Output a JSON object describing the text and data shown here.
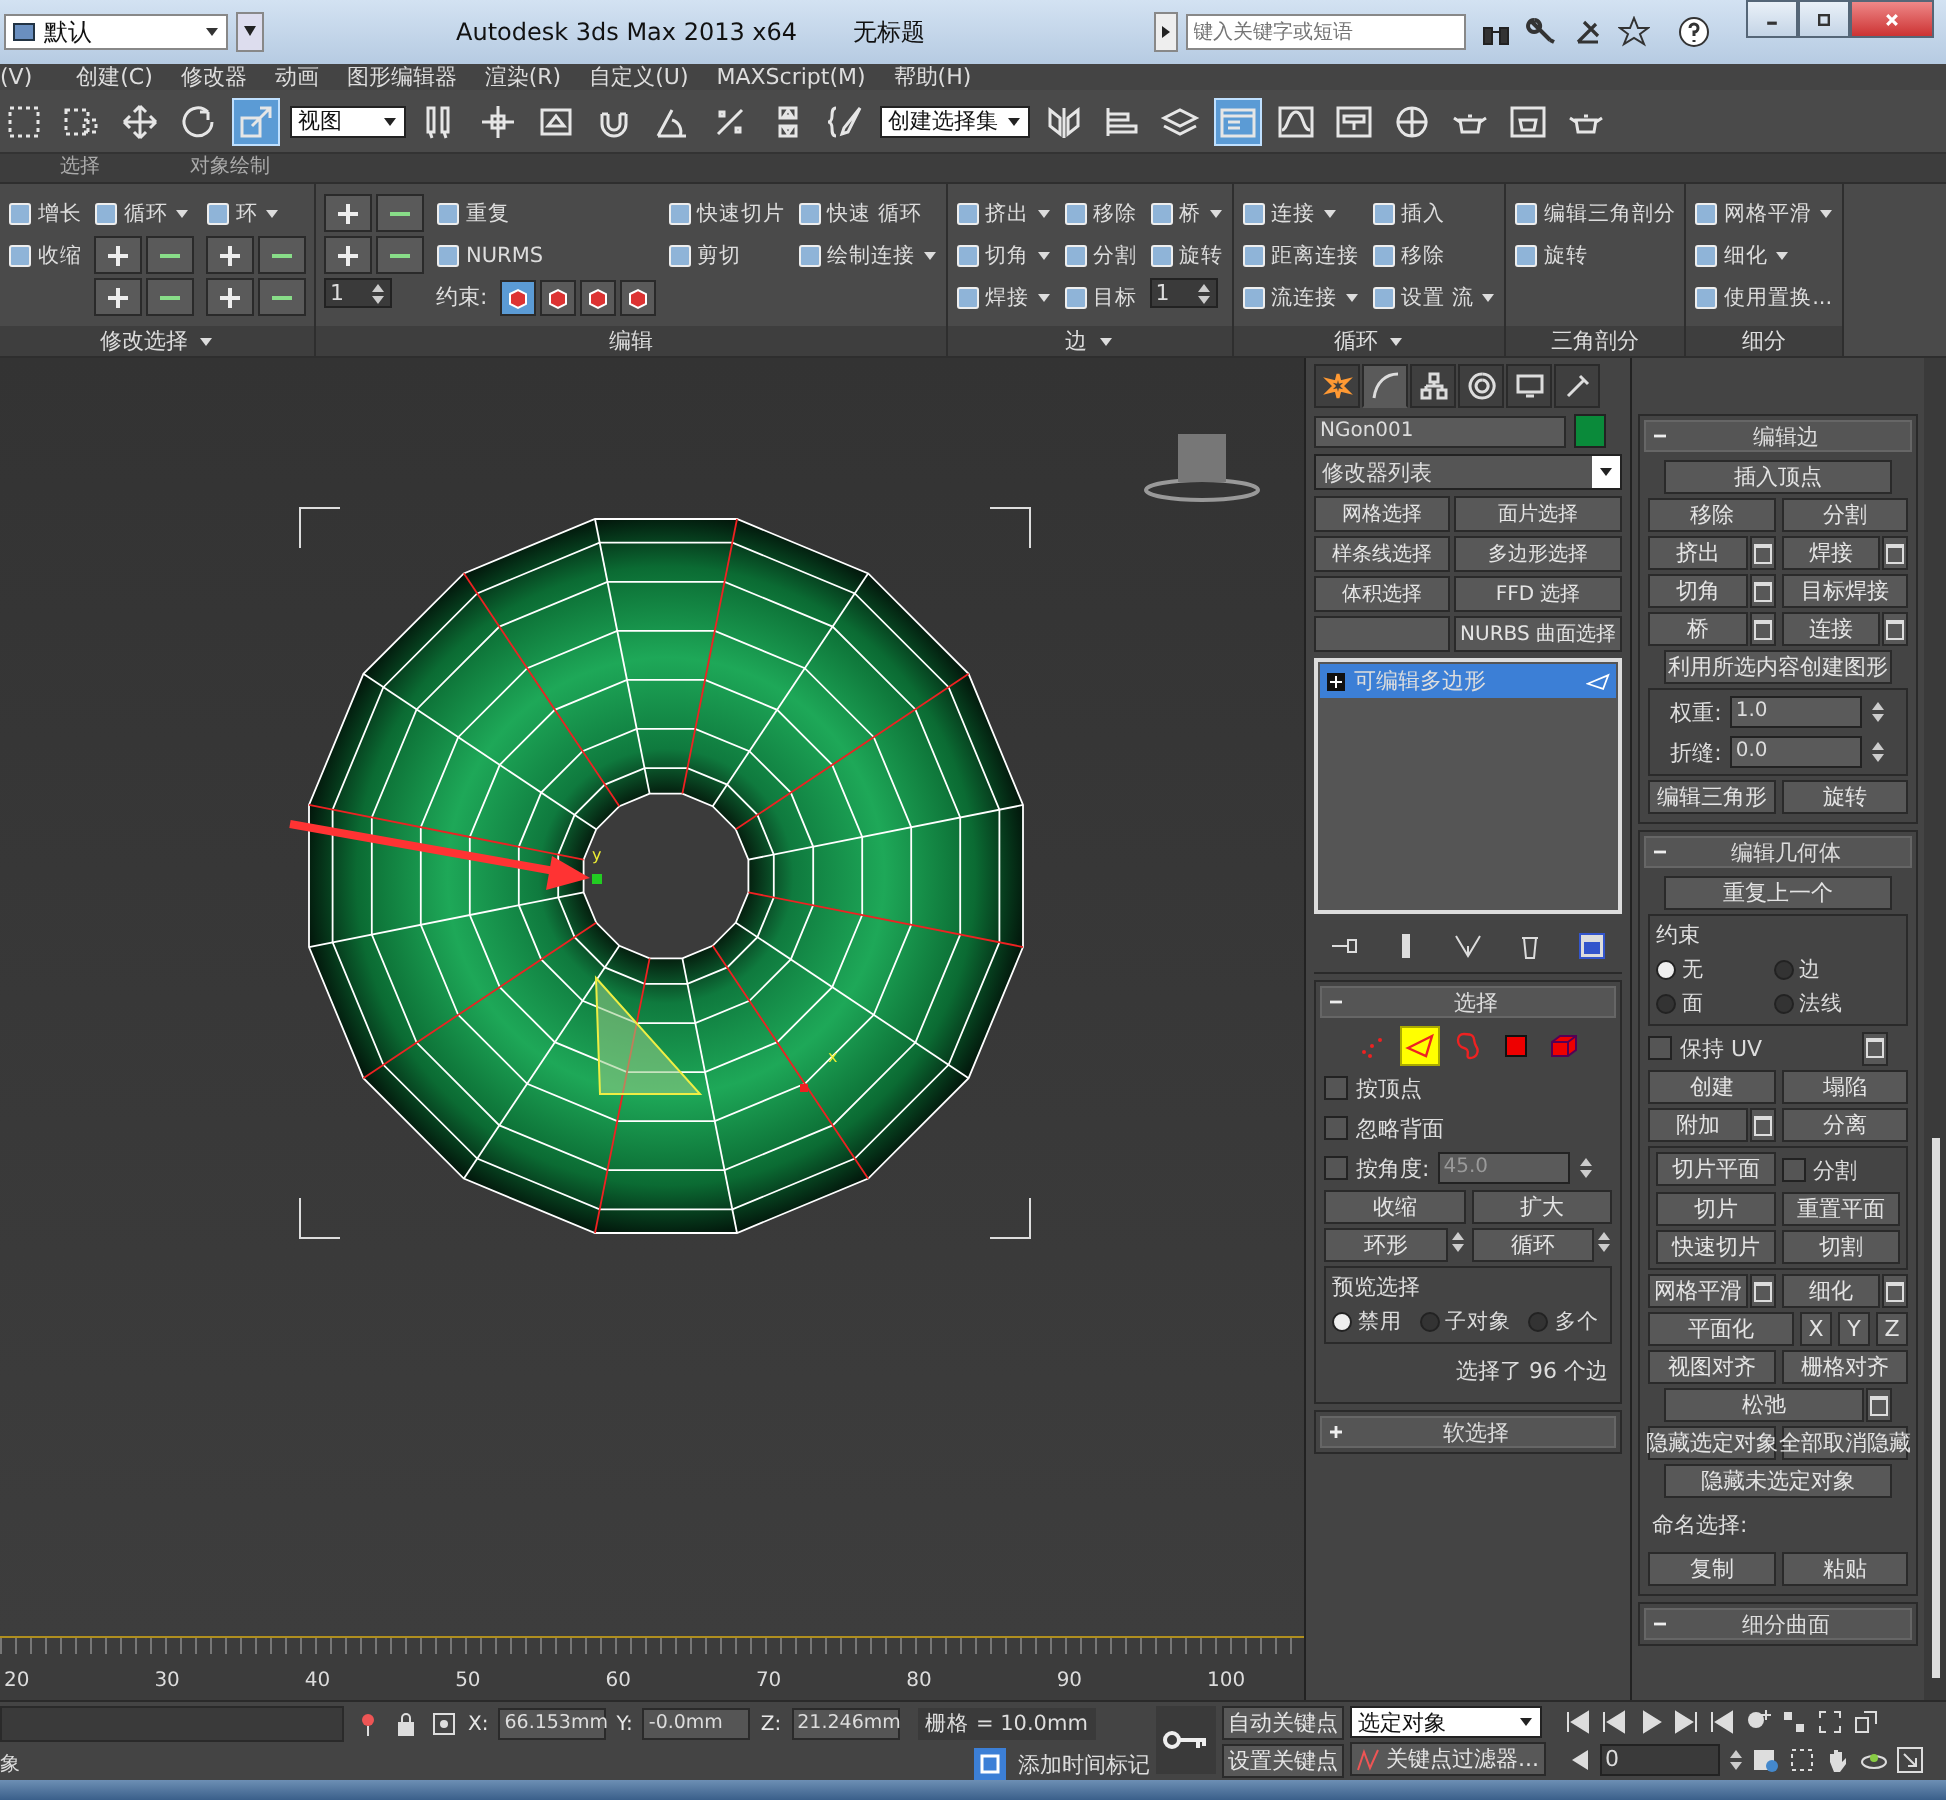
{
  "title_bar": {
    "workspace": "默认",
    "app_title": "Autodesk 3ds Max 2013 x64",
    "document_title": "无标题",
    "search": {
      "placeholder": "键入关键字或短语"
    }
  },
  "menu_bar": [
    "(V)",
    "创建(C)",
    "修改器",
    "动画",
    "图形编辑器",
    "渲染(R)",
    "自定义(U)",
    "MAXScript(M)",
    "帮助(H)"
  ],
  "toolbar": [
    {
      "kind": "tool",
      "selected": false
    },
    {
      "kind": "tool",
      "selected": false
    },
    {
      "kind": "tool",
      "selected": false
    },
    {
      "kind": "tool",
      "selected": false
    },
    {
      "kind": "tool",
      "selected": true
    },
    {
      "kind": "dropdown",
      "value": "视图"
    },
    {
      "kind": "tool",
      "selected": false
    },
    {
      "kind": "tool",
      "selected": false
    },
    {
      "kind": "tool",
      "selected": false
    },
    {
      "kind": "tool",
      "selected": false
    },
    {
      "kind": "tool",
      "selected": false
    },
    {
      "kind": "tool",
      "selected": false
    },
    {
      "kind": "tool",
      "selected": false
    },
    {
      "kind": "tool",
      "selected": false
    },
    {
      "kind": "dropdown",
      "value": "创建选择集"
    },
    {
      "kind": "tool",
      "selected": false
    },
    {
      "kind": "tool",
      "selected": false
    },
    {
      "kind": "tool",
      "selected": false
    },
    {
      "kind": "tool",
      "selected": true
    },
    {
      "kind": "tool",
      "selected": false
    },
    {
      "kind": "tool",
      "selected": false
    },
    {
      "kind": "tool",
      "selected": false
    },
    {
      "kind": "tool",
      "selected": false
    },
    {
      "kind": "tool",
      "selected": false
    },
    {
      "kind": "tool",
      "selected": false
    }
  ],
  "ribbon_tabs": [
    "选择",
    "对象绘制"
  ],
  "ribbon_groups": [
    {
      "title": "修改选择",
      "dropdown": true,
      "columns": [
        [
          {
            "kind": "button",
            "label": "增长"
          },
          {
            "kind": "button",
            "label": "收缩"
          }
        ],
        [
          {
            "kind": "button",
            "label": "循环",
            "dropdown": true
          },
          {
            "kind": "icons"
          },
          {
            "kind": "icons"
          }
        ],
        [
          {
            "kind": "button",
            "label": "环",
            "dropdown": true
          },
          {
            "kind": "icons"
          },
          {
            "kind": "icons"
          }
        ]
      ]
    },
    {
      "title": "编辑",
      "dropdown": false,
      "columns": [
        [
          {
            "kind": "icons"
          },
          {
            "kind": "icons"
          },
          {
            "kind": "spinner",
            "value": "1"
          }
        ],
        [
          {
            "kind": "button",
            "label": "重复"
          },
          {
            "kind": "button",
            "label": "NURMS"
          },
          {
            "kind": "constraints",
            "label": "约束:",
            "options": [
              {
                "selected": true
              },
              {
                "selected": false
              },
              {
                "selected": false
              },
              {
                "selected": false
              }
            ]
          }
        ],
        [
          {
            "kind": "button",
            "label": "快速切片"
          },
          {
            "kind": "button",
            "label": "剪切"
          }
        ],
        [
          {
            "kind": "button",
            "label": "快速 循环"
          },
          {
            "kind": "button",
            "label": "绘制连接",
            "dropdown": true
          }
        ]
      ]
    },
    {
      "title": "边",
      "dropdown": true,
      "columns": [
        [
          {
            "kind": "button",
            "label": "挤出",
            "dropdown": true
          },
          {
            "kind": "button",
            "label": "切角",
            "dropdown": true
          },
          {
            "kind": "button",
            "label": "焊接",
            "dropdown": true
          }
        ],
        [
          {
            "kind": "button",
            "label": "移除"
          },
          {
            "kind": "button",
            "label": "分割"
          },
          {
            "kind": "button",
            "label": "目标"
          }
        ],
        [
          {
            "kind": "button",
            "label": "桥",
            "dropdown": true
          },
          {
            "kind": "button",
            "label": "旋转"
          },
          {
            "kind": "spinner",
            "value": "1"
          }
        ]
      ]
    },
    {
      "title": "循环",
      "dropdown": true,
      "columns": [
        [
          {
            "kind": "button",
            "label": "连接",
            "dropdown": true
          },
          {
            "kind": "button",
            "label": "距离连接"
          },
          {
            "kind": "button",
            "label": "流连接",
            "dropdown": true
          }
        ],
        [
          {
            "kind": "button",
            "label": "插入"
          },
          {
            "kind": "button",
            "label": "移除"
          },
          {
            "kind": "button",
            "label": "设置 流",
            "dropdown": true
          }
        ]
      ]
    },
    {
      "title": "三角剖分",
      "dropdown": false,
      "columns": [
        [
          {
            "kind": "button",
            "label": "编辑三角剖分"
          },
          {
            "kind": "button",
            "label": "旋转"
          }
        ]
      ]
    },
    {
      "title": "细分",
      "dropdown": false,
      "columns": [
        [
          {
            "kind": "button",
            "label": "网格平滑",
            "dropdown": true
          },
          {
            "kind": "button",
            "label": "细化",
            "dropdown": true
          },
          {
            "kind": "button",
            "label": "使用置换..."
          }
        ]
      ]
    }
  ],
  "viewport": {
    "axis_labels": [
      "y",
      "x"
    ]
  },
  "command_panel": {
    "tabs": [
      {
        "selected": false
      },
      {
        "selected": true
      },
      {
        "selected": false
      },
      {
        "selected": false
      },
      {
        "selected": false
      },
      {
        "selected": false
      }
    ],
    "object": {
      "name": "NGon001",
      "color": "#0a8a3a"
    },
    "modifier_list": "修改器列表",
    "modifier_buttons": [
      {
        "kind": "button",
        "label": "网格选择"
      },
      {
        "kind": "button",
        "label": "面片选择"
      },
      {
        "kind": "button",
        "label": "样条线选择"
      },
      {
        "kind": "button",
        "label": "多边形选择"
      },
      {
        "kind": "button",
        "label": "体积选择"
      },
      {
        "kind": "button",
        "label": "FFD 选择"
      },
      {
        "kind": "blank"
      },
      {
        "kind": "button",
        "label": "NURBS 曲面选择"
      }
    ],
    "stack": [
      {
        "label": "可编辑多边形",
        "selected": true
      }
    ],
    "rollouts": [
      {
        "title": "选择",
        "expanded": true,
        "items": [
          {
            "kind": "levels",
            "levels": [
              {
                "kind": "vertex",
                "selected": false
              },
              {
                "kind": "edge",
                "selected": true
              },
              {
                "kind": "border",
                "selected": false
              },
              {
                "kind": "polygon",
                "selected": false
              },
              {
                "kind": "element",
                "selected": false
              }
            ]
          },
          {
            "kind": "check",
            "label": "按顶点",
            "checked": false
          },
          {
            "kind": "check",
            "label": "忽略背面",
            "checked": false
          },
          {
            "kind": "check",
            "label": "按角度:",
            "checked": false,
            "value": "45.0"
          },
          {
            "kind": "buttons",
            "buttons": [
              {
                "label": "收缩"
              },
              {
                "label": "扩大"
              }
            ]
          },
          {
            "kind": "buttons",
            "buttons": [
              {
                "label": "环形",
                "spinner": true
              },
              {
                "label": "循环",
                "spinner": true
              }
            ]
          },
          {
            "kind": "group",
            "title": "预览选择",
            "items": [
              {
                "kind": "radios",
                "options": [
                  {
                    "label": "禁用",
                    "selected": true
                  },
                  {
                    "label": "子对象",
                    "selected": false
                  },
                  {
                    "label": "多个",
                    "selected": false
                  }
                ]
              }
            ]
          },
          {
            "kind": "text",
            "text": "选择了 96 个边"
          }
        ]
      },
      {
        "title": "软选择",
        "expanded": false
      }
    ]
  },
  "right_panel": {
    "rollouts": [
      {
        "title": "编辑边",
        "expanded": true,
        "items": [
          {
            "kind": "buttons",
            "buttons": [
              {
                "label": "插入顶点"
              }
            ]
          },
          {
            "kind": "buttons",
            "buttons": [
              {
                "label": "移除"
              },
              {
                "label": "分割"
              }
            ]
          },
          {
            "kind": "buttons",
            "buttons": [
              {
                "label": "挤出",
                "settings": true
              },
              {
                "label": "焊接",
                "settings": true
              }
            ]
          },
          {
            "kind": "buttons",
            "buttons": [
              {
                "label": "切角",
                "settings": true
              },
              {
                "label": "目标焊接"
              }
            ]
          },
          {
            "kind": "buttons",
            "buttons": [
              {
                "label": "桥",
                "settings": true
              },
              {
                "label": "连接",
                "settings": true
              }
            ]
          },
          {
            "kind": "buttons",
            "buttons": [
              {
                "label": "利用所选内容创建图形"
              }
            ]
          },
          {
            "kind": "group",
            "items": [
              {
                "kind": "field",
                "label": "权重:",
                "value": "1.0"
              },
              {
                "kind": "field",
                "label": "折缝:",
                "value": "0.0"
              }
            ]
          },
          {
            "kind": "buttons",
            "buttons": [
              {
                "label": "编辑三角形"
              },
              {
                "label": "旋转"
              }
            ]
          }
        ]
      },
      {
        "title": "编辑几何体",
        "expanded": true,
        "items": [
          {
            "kind": "buttons",
            "buttons": [
              {
                "label": "重复上一个"
              }
            ]
          },
          {
            "kind": "group",
            "title": "约束",
            "items": [
              {
                "kind": "radios",
                "options": [
                  {
                    "label": "无",
                    "selected": true
                  },
                  {
                    "label": "边",
                    "selected": false
                  },
                  {
                    "label": "面",
                    "selected": false
                  },
                  {
                    "label": "法线",
                    "selected": false
                  }
                ]
              }
            ]
          },
          {
            "kind": "check",
            "label": "保持 UV",
            "checked": false,
            "settings": true
          },
          {
            "kind": "buttons",
            "buttons": [
              {
                "label": "创建"
              },
              {
                "label": "塌陷"
              }
            ]
          },
          {
            "kind": "buttons",
            "buttons": [
              {
                "label": "附加",
                "settings": true
              },
              {
                "label": "分离"
              }
            ]
          },
          {
            "kind": "group",
            "items": [
              {
                "kind": "buttons",
                "buttons": [
                  {
                    "label": "切片平面"
                  },
                  {
                    "kind": "check",
                    "label": "分割",
                    "checked": false
                  }
                ]
              },
              {
                "kind": "buttons",
                "buttons": [
                  {
                    "label": "切片"
                  },
                  {
                    "label": "重置平面"
                  }
                ]
              },
              {
                "kind": "buttons",
                "buttons": [
                  {
                    "label": "快速切片"
                  },
                  {
                    "label": "切割"
                  }
                ]
              }
            ]
          },
          {
            "kind": "buttons",
            "buttons": [
              {
                "label": "网格平滑",
                "settings": true
              },
              {
                "label": "细化",
                "settings": true
              }
            ]
          },
          {
            "kind": "buttons",
            "buttons": [
              {
                "label": "平面化"
              },
              {
                "kind": "axis",
                "label": "X"
              },
              {
                "kind": "axis",
                "label": "Y"
              },
              {
                "kind": "axis",
                "label": "Z"
              }
            ]
          },
          {
            "kind": "buttons",
            "buttons": [
              {
                "label": "视图对齐"
              },
              {
                "label": "栅格对齐"
              }
            ]
          },
          {
            "kind": "buttons",
            "buttons": [
              {
                "label": "松弛",
                "settings": true
              }
            ]
          },
          {
            "kind": "buttons",
            "buttons": [
              {
                "label": "隐藏选定对象"
              },
              {
                "label": "全部取消隐藏"
              }
            ]
          },
          {
            "kind": "buttons",
            "buttons": [
              {
                "label": "隐藏未选定对象"
              }
            ]
          },
          {
            "kind": "text",
            "text": "命名选择:"
          },
          {
            "kind": "buttons",
            "buttons": [
              {
                "label": "复制"
              },
              {
                "label": "粘贴"
              }
            ]
          }
        ]
      },
      {
        "title": "细分曲面",
        "expanded": true
      }
    ]
  },
  "timeline": {
    "labels": [
      "20",
      "30",
      "40",
      "50",
      "60",
      "70",
      "80",
      "90",
      "100"
    ]
  },
  "status_bar": {
    "prompt": "象",
    "coords": [
      {
        "label": "X:",
        "value": "66.153mm"
      },
      {
        "label": "Y:",
        "value": "-0.0mm"
      },
      {
        "label": "Z:",
        "value": "21.246mm"
      }
    ],
    "grid": "栅格 = 10.0mm",
    "auto_key": "自动关键点",
    "key_target": "选定对象",
    "set_key": "设置关键点",
    "key_filters": "关键点过滤器...",
    "add_time_tag": "添加时间标记",
    "frame": "0"
  }
}
